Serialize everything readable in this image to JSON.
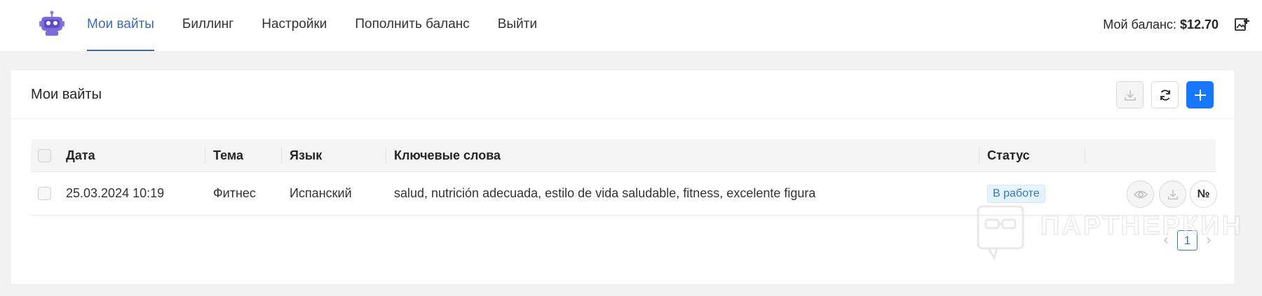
{
  "nav": {
    "items": [
      {
        "label": "Мои вайты",
        "active": true
      },
      {
        "label": "Биллинг",
        "active": false
      },
      {
        "label": "Настройки",
        "active": false
      },
      {
        "label": "Пополнить баланс",
        "active": false
      },
      {
        "label": "Выйти",
        "active": false
      }
    ],
    "balance_label": "Мой баланс:",
    "balance_value": "$12.70"
  },
  "card": {
    "title": "Мои вайты",
    "buttons": {
      "download": "download-icon",
      "refresh": "refresh-icon",
      "add": "plus-icon"
    }
  },
  "table": {
    "columns": [
      "Дата",
      "Тема",
      "Язык",
      "Ключевые слова",
      "Статус"
    ],
    "rows": [
      {
        "date": "25.03.2024 10:19",
        "topic": "Фитнес",
        "language": "Испанский",
        "keywords": "salud, nutrición adecuada, estilo de vida saludable, fitness, excelente figura",
        "status": "В работе",
        "number_label": "№"
      }
    ]
  },
  "pagination": {
    "current": "1"
  },
  "watermark": {
    "text": "ПАРТНЕРКИН"
  },
  "colors": {
    "accent": "#3d6bb3",
    "primary": "#1677ff",
    "status_bg": "#e6f4ff",
    "status_text": "#3578c5"
  }
}
